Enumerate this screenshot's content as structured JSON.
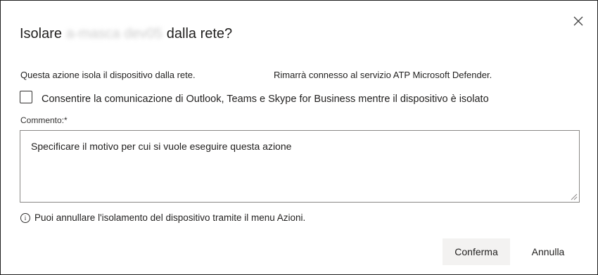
{
  "dialog": {
    "title_prefix": "Isolare",
    "title_device": "a-masca dev05",
    "title_suffix": "dalla rete?",
    "close_icon": "close-icon"
  },
  "description": {
    "part1": "Questa azione isola il dispositivo dalla rete.",
    "part2": "Rimarrà connesso al servizio ATP Microsoft Defender."
  },
  "option": {
    "label": "Consentire la comunicazione di Outlook, Teams e Skype for Business mentre il dispositivo è isolato",
    "checked": false
  },
  "comment": {
    "label": "Commento:*",
    "value": "",
    "placeholder": "Specificare il motivo per cui si vuole eseguire questa azione"
  },
  "info": {
    "icon": "info-icon",
    "text": "Puoi annullare l'isolamento del dispositivo tramite il menu Azioni."
  },
  "buttons": {
    "confirm": "Conferma",
    "cancel": "Annulla"
  },
  "colors": {
    "text": "#201f1e",
    "border": "#1f1f1f",
    "confirm_bg": "#f3f2f1"
  }
}
